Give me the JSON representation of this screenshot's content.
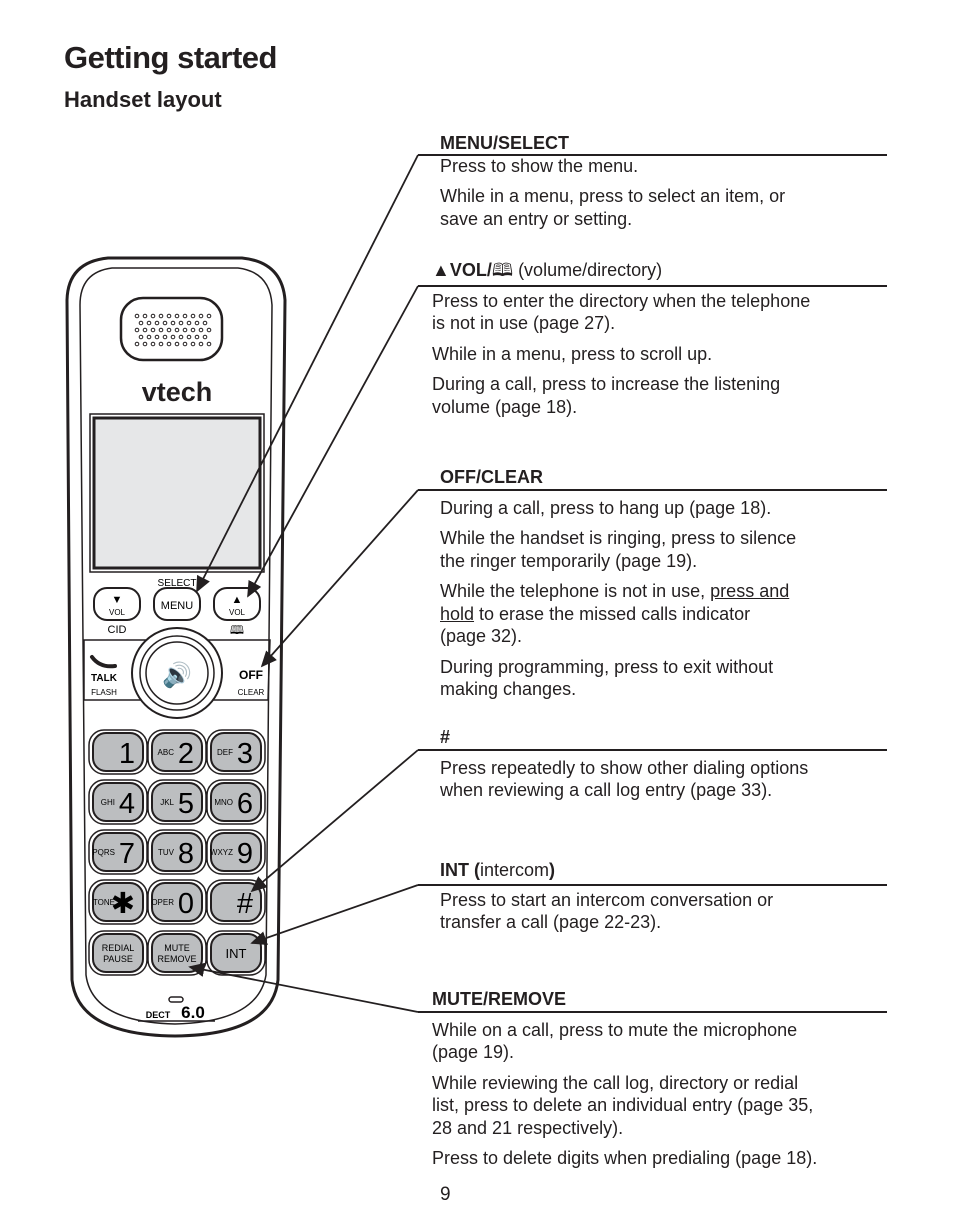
{
  "title": "Getting started",
  "subtitle": "Handset layout",
  "page_number": "9",
  "sections": {
    "menu": {
      "heading": "MENU/SELECT",
      "paras": [
        [
          "Press to show the menu."
        ],
        [
          "While in a menu, press to select an item, or",
          "save an entry or setting."
        ]
      ]
    },
    "vol": {
      "heading": "▲VOL/",
      "heading_rest": " (volume/directory)",
      "paras": [
        [
          "Press to enter the directory when the telephone",
          "is not in use (page 27)."
        ],
        [
          "While in a menu, press to scroll up."
        ],
        [
          "During a call, press to increase the listening",
          "volume (page 18)."
        ]
      ]
    },
    "off": {
      "heading": "OFF/CLEAR",
      "paras": [
        [
          "During a call, press to hang up (page 18)."
        ],
        [
          "While the handset is ringing, press to silence",
          "the ringer temporarily (page 19)."
        ]
      ],
      "p3_pre": "While the telephone is not in use, ",
      "p3_u1": "press and ",
      "p3_u2": "hold",
      "p3_rest": " to erase the missed calls indicator",
      "p3_l3": "(page 32).",
      "p4": [
        "During programming, press to exit without",
        "making changes."
      ]
    },
    "hash": {
      "heading": "#",
      "paras": [
        [
          "Press repeatedly to show other dialing options",
          "when reviewing a call log entry (page 33)."
        ]
      ]
    },
    "int": {
      "heading": "INT (",
      "heading_mid": "intercom",
      "heading_end": ")",
      "paras": [
        [
          "Press to start an intercom conversation or",
          "transfer a call (page 22-23)."
        ]
      ]
    },
    "mute": {
      "heading": "MUTE/REMOVE",
      "paras": [
        [
          "While on a call, press to mute the microphone",
          "(page 19)."
        ],
        [
          "While reviewing the call log, directory or redial",
          "list, press to delete an individual entry (page 35,",
          "28 and 21 respectively)."
        ],
        [
          "Press to delete digits when predialing (page 18)."
        ]
      ]
    }
  },
  "handset": {
    "brand": "vtech",
    "dect": "DECT",
    "dect_ver": "6.0",
    "select": "SELECT",
    "menu": "MENU",
    "vol": "VOL",
    "cid": "CID",
    "talk": "TALK",
    "flash": "FLASH",
    "off": "OFF",
    "clear": "CLEAR",
    "keys": [
      [
        "1",
        ""
      ],
      [
        "2",
        "ABC"
      ],
      [
        "3",
        "DEF"
      ],
      [
        "4",
        "GHI"
      ],
      [
        "5",
        "JKL"
      ],
      [
        "6",
        "MNO"
      ],
      [
        "7",
        "PQRS"
      ],
      [
        "8",
        "TUV"
      ],
      [
        "9",
        "WXYZ"
      ],
      [
        "✱",
        "TONE"
      ],
      [
        "0",
        "OPER"
      ],
      [
        "#",
        ""
      ]
    ],
    "redial": "REDIAL",
    "pause": "PAUSE",
    "mute": "MUTE",
    "remove": "REMOVE",
    "int": "INT"
  },
  "colors": {
    "ink": "#231f20",
    "key_fill": "#bcbec0",
    "screen": "#e6e7e8"
  }
}
